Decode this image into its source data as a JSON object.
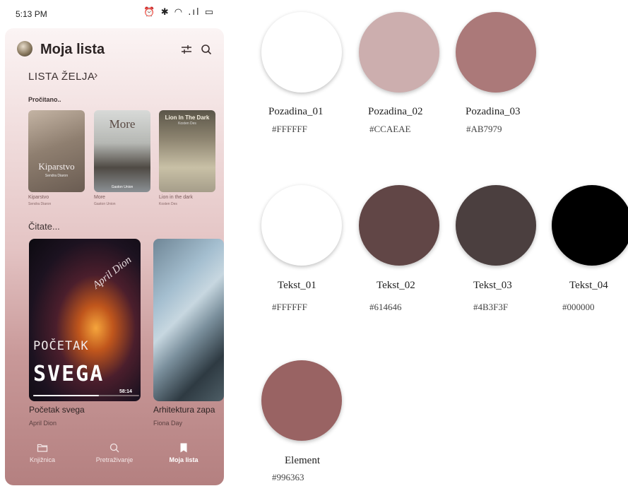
{
  "status_bar": {
    "time": "5:13 PM",
    "icons": "⏰ ✱ ◠ .ıl ▭"
  },
  "app": {
    "title": "Moja lista",
    "wishlist_link": "LISTA ŽELJA",
    "sections": {
      "read_label": "Pročitano..",
      "reading_label": "Čitate..."
    },
    "read_books": [
      {
        "title": "Kiparstvo",
        "author": "Sendra Diaron",
        "cover_title": "Kiparstvo",
        "cover_sub": "Sendra Diaron"
      },
      {
        "title": "More",
        "author": "Gaston Union",
        "cover_title": "More",
        "cover_sub": "Gaston Union"
      },
      {
        "title": "Lion in the dark",
        "author": "Kosten Des",
        "cover_title": "Lion In The Dark",
        "cover_sub": "Kosten Des"
      }
    ],
    "reading_books": [
      {
        "title": "Početak svega",
        "author": "April Dion",
        "cover_line1": "POČETAK",
        "cover_line2": "SVEGA",
        "cover_author": "April Dion",
        "time_left": "58:14",
        "progress": 0.62
      },
      {
        "title": "Arhitektura zapa",
        "author": "Fiona Day"
      }
    ],
    "nav": [
      {
        "label": "Knjižnica",
        "icon": "folder-icon",
        "active": false
      },
      {
        "label": "Pretraživanje",
        "icon": "search-icon",
        "active": false
      },
      {
        "label": "Moja lista",
        "icon": "bookmark-icon",
        "active": true
      }
    ]
  },
  "palette": [
    {
      "name": "Pozadina_01",
      "hex": "#FFFFFF",
      "color": "#FFFFFF"
    },
    {
      "name": "Pozadina_02",
      "hex": "#CCAEAE",
      "color": "#CCAEAE"
    },
    {
      "name": "Pozadina_03",
      "hex": "#AB7979",
      "color": "#AB7979"
    },
    {
      "name": "Tekst_01",
      "hex": "#FFFFFF",
      "color": "#FFFFFF"
    },
    {
      "name": "Tekst_02",
      "hex": "#614646",
      "color": "#614646"
    },
    {
      "name": "Tekst_03",
      "hex": "#4B3F3F",
      "color": "#4B3F3F"
    },
    {
      "name": "Tekst_04",
      "hex": "#000000",
      "color": "#000000"
    },
    {
      "name": "Element",
      "hex": "#996363",
      "color": "#996363"
    }
  ]
}
